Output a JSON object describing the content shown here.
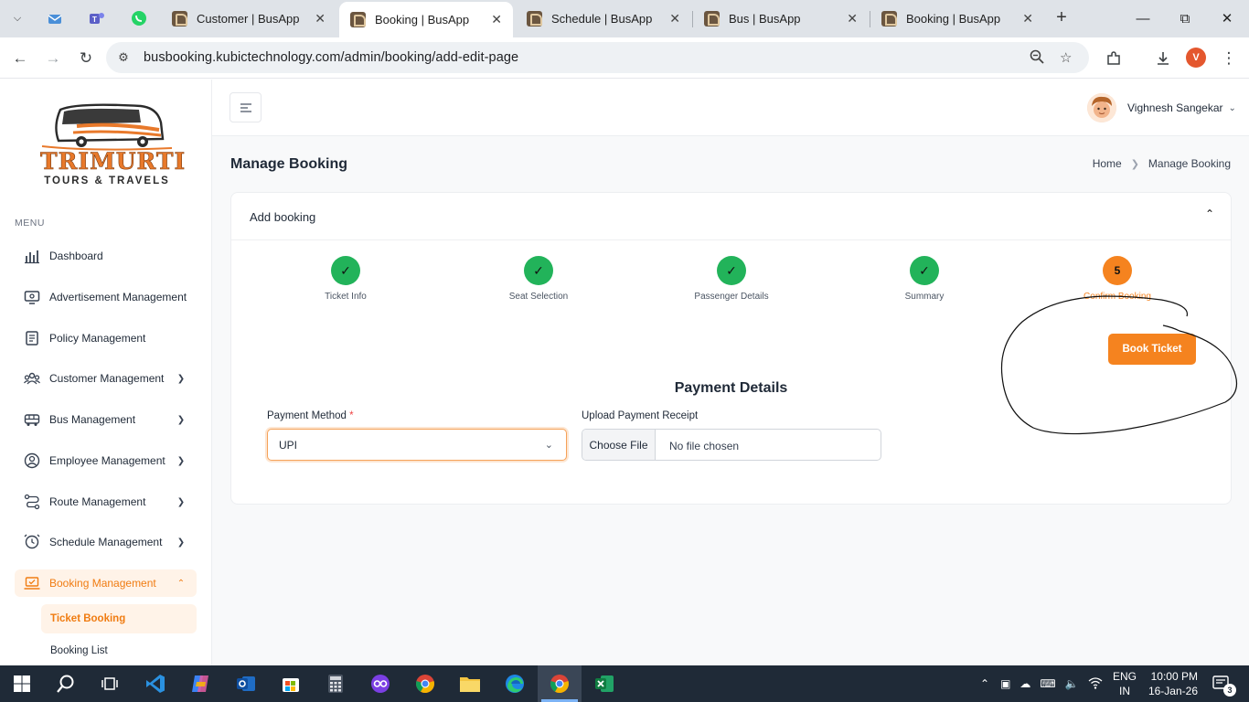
{
  "browser": {
    "tabs": [
      {
        "title": "Customer | BusApp"
      },
      {
        "title": "Booking | BusApp"
      },
      {
        "title": "Schedule | BusApp"
      },
      {
        "title": "Bus | BusApp"
      },
      {
        "title": "Booking | BusApp"
      }
    ],
    "url": "busbooking.kubictechnology.com/admin/booking/add-edit-page",
    "profile_initial": "V"
  },
  "logo": {
    "line1": "TRIMURTI",
    "line2": "TOURS & TRAVELS"
  },
  "sidebar": {
    "menu_label": "MENU",
    "items": [
      {
        "label": "Dashboard",
        "icon": "bar-chart-icon"
      },
      {
        "label": "Advertisement Management",
        "icon": "monitor-icon"
      },
      {
        "label": "Policy Management",
        "icon": "document-icon"
      },
      {
        "label": "Customer Management",
        "icon": "users-icon"
      },
      {
        "label": "Bus Management",
        "icon": "bus-icon"
      },
      {
        "label": "Employee Management",
        "icon": "user-circle-icon"
      },
      {
        "label": "Route Management",
        "icon": "route-icon"
      },
      {
        "label": "Schedule Management",
        "icon": "clock-icon"
      },
      {
        "label": "Booking Management",
        "icon": "laptop-icon"
      }
    ],
    "sub_items": [
      {
        "label": "Ticket Booking"
      },
      {
        "label": "Booking List"
      }
    ]
  },
  "header": {
    "user_name": "Vighnesh Sangekar"
  },
  "page": {
    "title": "Manage Booking",
    "breadcrumb": {
      "home": "Home",
      "current": "Manage Booking"
    },
    "card_title": "Add booking",
    "steps": [
      {
        "label": "Ticket Info",
        "state": "done"
      },
      {
        "label": "Seat Selection",
        "state": "done"
      },
      {
        "label": "Passenger Details",
        "state": "done"
      },
      {
        "label": "Summary",
        "state": "done"
      },
      {
        "label": "Confirm Booking",
        "state": "current",
        "number": "5"
      }
    ],
    "book_button": "Book Ticket",
    "section_title": "Payment Details",
    "payment_method_label": "Payment Method",
    "required_mark": "*",
    "payment_method_value": "UPI",
    "upload_label": "Upload Payment Receipt",
    "choose_file": "Choose File",
    "no_file": "No file chosen"
  },
  "taskbar": {
    "lang1": "ENG",
    "lang2": "IN",
    "time": "10:00 PM",
    "date": "16-Jan-26",
    "notifications": "3"
  },
  "colors": {
    "accent": "#f5831f",
    "success": "#22b35a",
    "taskbar": "#1f2a37"
  }
}
